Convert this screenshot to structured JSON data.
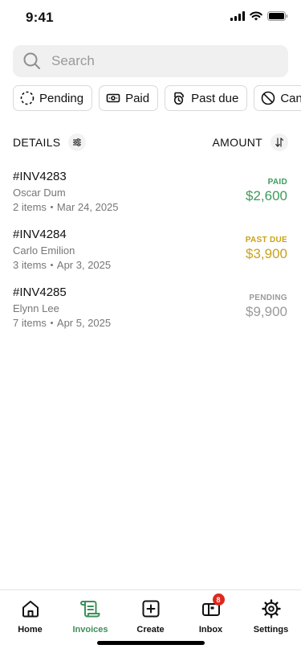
{
  "status_bar": {
    "time": "9:41",
    "icons": [
      "signal-icon",
      "wifi-icon",
      "battery-icon"
    ]
  },
  "search": {
    "placeholder": "Search"
  },
  "filters": [
    {
      "label": "Pending",
      "icon": "pending-dashed-circle-icon"
    },
    {
      "label": "Paid",
      "icon": "cash-icon"
    },
    {
      "label": "Past due",
      "icon": "overdue-clock-icon"
    },
    {
      "label": "Cancelled",
      "icon": "cancel-circle-icon"
    }
  ],
  "list_header": {
    "details_label": "DETAILS",
    "amount_label": "AMOUNT"
  },
  "invoices": [
    {
      "id": "#INV4283",
      "client": "Oscar Dum",
      "items": "2 items",
      "date": "Mar 24, 2025",
      "status": "PAID",
      "amount": "$2,600",
      "status_color": "#3d9b5a"
    },
    {
      "id": "#INV4284",
      "client": "Carlo Emilion",
      "items": "3 items",
      "date": "Apr 3, 2025",
      "status": "PAST DUE",
      "amount": "$3,900",
      "status_color": "#c9a21a"
    },
    {
      "id": "#INV4285",
      "client": "Elynn Lee",
      "items": "7 items",
      "date": "Apr 5, 2025",
      "status": "PENDING",
      "amount": "$9,900",
      "status_color": "#9a9a9a"
    }
  ],
  "tab_bar": {
    "tabs": [
      {
        "label": "Home",
        "icon": "home-icon"
      },
      {
        "label": "Invoices",
        "icon": "invoice-scroll-icon",
        "active": true
      },
      {
        "label": "Create",
        "icon": "plus-square-icon"
      },
      {
        "label": "Inbox",
        "icon": "inbox-icon",
        "badge": "8"
      },
      {
        "label": "Settings",
        "icon": "gear-icon"
      }
    ]
  },
  "colors": {
    "accent": "#3d8f5a",
    "paid": "#3d9b5a",
    "past_due": "#c9a21a",
    "pending": "#9a9a9a",
    "badge": "#e0271c"
  }
}
